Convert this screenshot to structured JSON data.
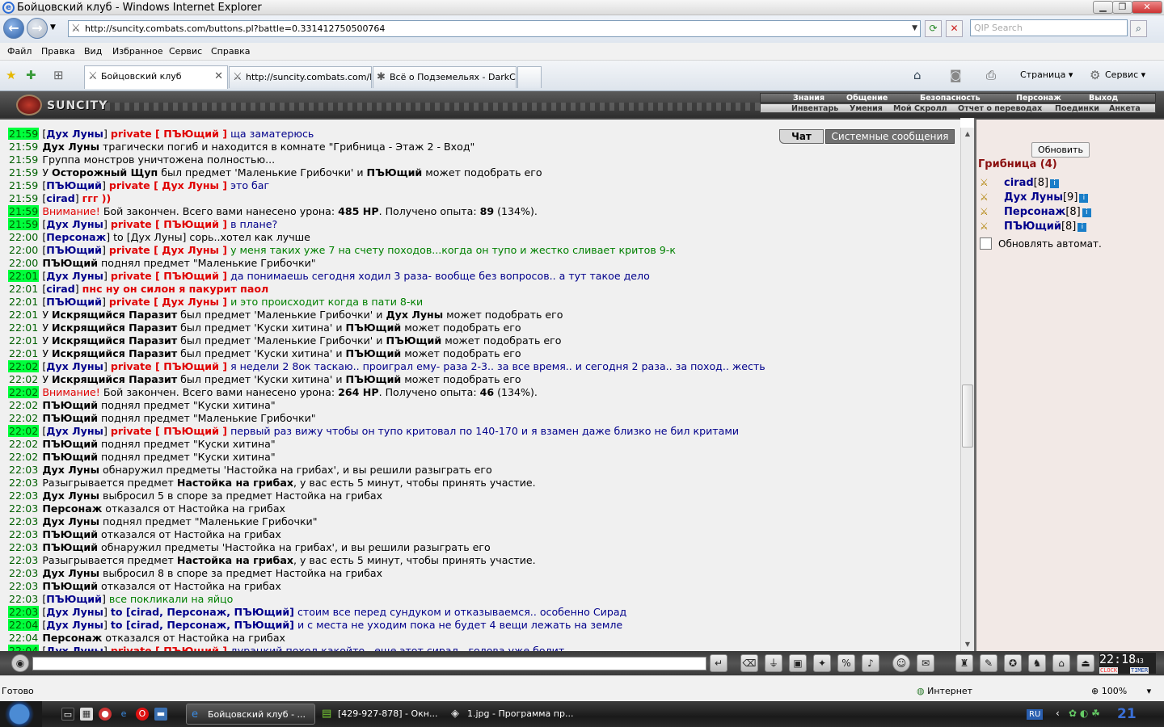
{
  "window": {
    "title": "Бойцовский клуб - Windows Internet Explorer"
  },
  "address": {
    "url": "http://suncity.combats.com/buttons.pl?battle=0.331412750500764",
    "search_placeholder": "QIP Search"
  },
  "menu": [
    "Файл",
    "Правка",
    "Вид",
    "Избранное",
    "Сервис",
    "Справка"
  ],
  "tabs": [
    "Бойцовский клуб",
    "http://suncity.combats.com/l...",
    "Всё о Подземельях - DarkCl..."
  ],
  "toolbar": {
    "page": "Страница",
    "service": "Сервис"
  },
  "game": {
    "logo": "SUNCITY",
    "top_menu": [
      "Знания",
      "Общение",
      "Безопасность",
      "Персонаж",
      "Выход"
    ],
    "sub_menu": [
      "Инвентарь",
      "Умения",
      "Мой Скролл",
      "Отчет о переводах",
      "Поединки",
      "Анкета"
    ]
  },
  "chat_tabs": {
    "chat": "Чат",
    "system": "Системные сообщения"
  },
  "chat": [
    {
      "time": "21:59",
      "hl": true,
      "parts": [
        [
          "t",
          "["
        ],
        [
          "nk",
          "Дух Луны"
        ],
        [
          "t",
          "] "
        ],
        [
          "pr",
          "private [ ПЪЮщий ]"
        ],
        [
          "pm",
          " ща заматерюсь"
        ]
      ]
    },
    {
      "time": "21:59",
      "hl": false,
      "parts": [
        [
          "b",
          "Дух Луны"
        ],
        [
          "t",
          " трагически погиб и находится в комнате \"Грибница - Этаж 2 - Вход\""
        ]
      ]
    },
    {
      "time": "21:59",
      "hl": false,
      "parts": [
        [
          "t",
          "Группа монстров уничтожена полностью..."
        ]
      ]
    },
    {
      "time": "21:59",
      "hl": false,
      "parts": [
        [
          "t",
          "У "
        ],
        [
          "b",
          "Осторожный Щуп"
        ],
        [
          "t",
          " был предмет 'Маленькие Грибочки' и "
        ],
        [
          "b",
          "ПЪЮщий"
        ],
        [
          "t",
          " может подобрать его"
        ]
      ]
    },
    {
      "time": "21:59",
      "hl": false,
      "parts": [
        [
          "t",
          "["
        ],
        [
          "nk",
          "ПЪЮщий"
        ],
        [
          "t",
          "] "
        ],
        [
          "pr",
          "private [ Дух Луны ]"
        ],
        [
          "pm",
          " это баг"
        ]
      ]
    },
    {
      "time": "21:59",
      "hl": false,
      "parts": [
        [
          "t",
          "["
        ],
        [
          "nk",
          "cirad"
        ],
        [
          "t",
          "] "
        ],
        [
          "pr",
          "ггг ))"
        ]
      ]
    },
    {
      "time": "21:59",
      "hl": true,
      "parts": [
        [
          "warn",
          "Внимание!"
        ],
        [
          "t",
          " Бой закончен. Всего вами нанесено урона: "
        ],
        [
          "b",
          "485 HP"
        ],
        [
          "t",
          ". Получено опыта: "
        ],
        [
          "b",
          "89"
        ],
        [
          "t",
          " (134%)."
        ]
      ]
    },
    {
      "time": "21:59",
      "hl": true,
      "parts": [
        [
          "t",
          "["
        ],
        [
          "nk",
          "Дух Луны"
        ],
        [
          "t",
          "] "
        ],
        [
          "pr",
          "private [ ПЪЮщий ]"
        ],
        [
          "pm",
          " в плане?"
        ]
      ]
    },
    {
      "time": "22:00",
      "hl": false,
      "parts": [
        [
          "t",
          "["
        ],
        [
          "nk",
          "Персонаж"
        ],
        [
          "t",
          "] "
        ],
        [
          "t",
          "to [Дух Луны] сорь..хотел как лучше"
        ]
      ]
    },
    {
      "time": "22:00",
      "hl": false,
      "parts": [
        [
          "t",
          "["
        ],
        [
          "nk",
          "ПЪЮщий"
        ],
        [
          "t",
          "] "
        ],
        [
          "pr",
          "private [ Дух Луны ]"
        ],
        [
          "green",
          " у меня таких уже 7 на счету походов...когда он тупо и жестко сливает критов 9-к"
        ]
      ]
    },
    {
      "time": "22:00",
      "hl": false,
      "parts": [
        [
          "b",
          "ПЪЮщий"
        ],
        [
          "t",
          " поднял предмет \"Маленькие Грибочки\""
        ]
      ]
    },
    {
      "time": "22:01",
      "hl": true,
      "parts": [
        [
          "t",
          "["
        ],
        [
          "nk",
          "Дух Луны"
        ],
        [
          "t",
          "] "
        ],
        [
          "pr",
          "private [ ПЪЮщий ]"
        ],
        [
          "pm",
          " да понимаешь сегодня ходил 3 раза- вообще без вопросов.. а тут такое дело"
        ]
      ]
    },
    {
      "time": "22:01",
      "hl": false,
      "parts": [
        [
          "t",
          "["
        ],
        [
          "nk",
          "cirad"
        ],
        [
          "t",
          "] "
        ],
        [
          "pr",
          "пнс ну он силон я пакурит паол"
        ]
      ]
    },
    {
      "time": "22:01",
      "hl": false,
      "parts": [
        [
          "t",
          "["
        ],
        [
          "nk",
          "ПЪЮщий"
        ],
        [
          "t",
          "] "
        ],
        [
          "pr",
          "private [ Дух Луны ]"
        ],
        [
          "green",
          " и это происходит когда в пати 8-ки"
        ]
      ]
    },
    {
      "time": "22:01",
      "hl": false,
      "parts": [
        [
          "t",
          "У "
        ],
        [
          "b",
          "Искрящийся Паразит"
        ],
        [
          "t",
          " был предмет 'Маленькие Грибочки' и "
        ],
        [
          "b",
          "Дух Луны"
        ],
        [
          "t",
          " может подобрать его"
        ]
      ]
    },
    {
      "time": "22:01",
      "hl": false,
      "parts": [
        [
          "t",
          "У "
        ],
        [
          "b",
          "Искрящийся Паразит"
        ],
        [
          "t",
          " был предмет 'Куски хитина' и "
        ],
        [
          "b",
          "ПЪЮщий"
        ],
        [
          "t",
          " может подобрать его"
        ]
      ]
    },
    {
      "time": "22:01",
      "hl": false,
      "parts": [
        [
          "t",
          "У "
        ],
        [
          "b",
          "Искрящийся Паразит"
        ],
        [
          "t",
          " был предмет 'Маленькие Грибочки' и "
        ],
        [
          "b",
          "ПЪЮщий"
        ],
        [
          "t",
          " может подобрать его"
        ]
      ]
    },
    {
      "time": "22:01",
      "hl": false,
      "parts": [
        [
          "t",
          "У "
        ],
        [
          "b",
          "Искрящийся Паразит"
        ],
        [
          "t",
          " был предмет 'Куски хитина' и "
        ],
        [
          "b",
          "ПЪЮщий"
        ],
        [
          "t",
          " может подобрать его"
        ]
      ]
    },
    {
      "time": "22:02",
      "hl": true,
      "parts": [
        [
          "t",
          "["
        ],
        [
          "nk",
          "Дух Луны"
        ],
        [
          "t",
          "] "
        ],
        [
          "pr",
          "private [ ПЪЮщий ]"
        ],
        [
          "pm",
          " я недели 2 8ок таскаю.. проиграл ему- раза 2-3.. за все время.. и сегодня 2 раза.. за поход.. жесть"
        ]
      ]
    },
    {
      "time": "22:02",
      "hl": false,
      "parts": [
        [
          "t",
          "У "
        ],
        [
          "b",
          "Искрящийся Паразит"
        ],
        [
          "t",
          " был предмет 'Куски хитина' и "
        ],
        [
          "b",
          "ПЪЮщий"
        ],
        [
          "t",
          " может подобрать его"
        ]
      ]
    },
    {
      "time": "22:02",
      "hl": true,
      "parts": [
        [
          "warn",
          "Внимание!"
        ],
        [
          "t",
          " Бой закончен. Всего вами нанесено урона: "
        ],
        [
          "b",
          "264 HP"
        ],
        [
          "t",
          ". Получено опыта: "
        ],
        [
          "b",
          "46"
        ],
        [
          "t",
          " (134%)."
        ]
      ]
    },
    {
      "time": "22:02",
      "hl": false,
      "parts": [
        [
          "b",
          "ПЪЮщий"
        ],
        [
          "t",
          " поднял предмет \"Куски хитина\""
        ]
      ]
    },
    {
      "time": "22:02",
      "hl": false,
      "parts": [
        [
          "b",
          "ПЪЮщий"
        ],
        [
          "t",
          " поднял предмет \"Маленькие Грибочки\""
        ]
      ]
    },
    {
      "time": "22:02",
      "hl": true,
      "parts": [
        [
          "t",
          "["
        ],
        [
          "nk",
          "Дух Луны"
        ],
        [
          "t",
          "] "
        ],
        [
          "pr",
          "private [ ПЪЮщий ]"
        ],
        [
          "pm",
          " первый раз вижу чтобы он тупо критовал по 140-170 и я взамен даже близко не бил критами"
        ]
      ]
    },
    {
      "time": "22:02",
      "hl": false,
      "parts": [
        [
          "b",
          "ПЪЮщий"
        ],
        [
          "t",
          " поднял предмет \"Куски хитина\""
        ]
      ]
    },
    {
      "time": "22:02",
      "hl": false,
      "parts": [
        [
          "b",
          "ПЪЮщий"
        ],
        [
          "t",
          " поднял предмет \"Куски хитина\""
        ]
      ]
    },
    {
      "time": "22:03",
      "hl": false,
      "parts": [
        [
          "b",
          "Дух Луны"
        ],
        [
          "t",
          " обнаружил предметы 'Настойка на грибах', и вы решили разыграть его"
        ]
      ]
    },
    {
      "time": "22:03",
      "hl": false,
      "parts": [
        [
          "t",
          "Разыгрывается предмет "
        ],
        [
          "b",
          "Настойка на грибах"
        ],
        [
          "t",
          ", у вас есть 5 минут, чтобы принять участие."
        ]
      ]
    },
    {
      "time": "22:03",
      "hl": false,
      "parts": [
        [
          "b",
          "Дух Луны"
        ],
        [
          "t",
          " выбросил 5 в споре за предмет Настойка на грибах"
        ]
      ]
    },
    {
      "time": "22:03",
      "hl": false,
      "parts": [
        [
          "b",
          "Персонаж"
        ],
        [
          "t",
          " отказался от Настойка на грибах"
        ]
      ]
    },
    {
      "time": "22:03",
      "hl": false,
      "parts": [
        [
          "b",
          "Дух Луны"
        ],
        [
          "t",
          " поднял предмет \"Маленькие Грибочки\""
        ]
      ]
    },
    {
      "time": "22:03",
      "hl": false,
      "parts": [
        [
          "b",
          "ПЪЮщий"
        ],
        [
          "t",
          " отказался от Настойка на грибах"
        ]
      ]
    },
    {
      "time": "22:03",
      "hl": false,
      "parts": [
        [
          "b",
          "ПЪЮщий"
        ],
        [
          "t",
          " обнаружил предметы 'Настойка на грибах', и вы решили разыграть его"
        ]
      ]
    },
    {
      "time": "22:03",
      "hl": false,
      "parts": [
        [
          "t",
          "Разыгрывается предмет "
        ],
        [
          "b",
          "Настойка на грибах"
        ],
        [
          "t",
          ", у вас есть 5 минут, чтобы принять участие."
        ]
      ]
    },
    {
      "time": "22:03",
      "hl": false,
      "parts": [
        [
          "b",
          "Дух Луны"
        ],
        [
          "t",
          " выбросил 8 в споре за предмет Настойка на грибах"
        ]
      ]
    },
    {
      "time": "22:03",
      "hl": false,
      "parts": [
        [
          "b",
          "ПЪЮщий"
        ],
        [
          "t",
          " отказался от Настойка на грибах"
        ]
      ]
    },
    {
      "time": "22:03",
      "hl": false,
      "parts": [
        [
          "t",
          "["
        ],
        [
          "nk",
          "ПЪЮщий"
        ],
        [
          "t",
          "] "
        ],
        [
          "green",
          "все покликали на яйцо"
        ]
      ]
    },
    {
      "time": "22:03",
      "hl": true,
      "parts": [
        [
          "t",
          "["
        ],
        [
          "nk",
          "Дух Луны"
        ],
        [
          "t",
          "] "
        ],
        [
          "nk",
          "to [cirad, Персонаж, ПЪЮщий]"
        ],
        [
          "pm",
          " стоим все перед сундуком и отказываемся.. особенно Сирад"
        ]
      ]
    },
    {
      "time": "22:04",
      "hl": true,
      "parts": [
        [
          "t",
          "["
        ],
        [
          "nk",
          "Дух Луны"
        ],
        [
          "t",
          "] "
        ],
        [
          "nk",
          "to [cirad, Персонаж, ПЪЮщий]"
        ],
        [
          "pm",
          " и с места не уходим пока не будет 4 вещи лежать на земле"
        ]
      ]
    },
    {
      "time": "22:04",
      "hl": false,
      "parts": [
        [
          "b",
          "Персонаж"
        ],
        [
          "t",
          " отказался от Настойка на грибах"
        ]
      ]
    },
    {
      "time": "22:04",
      "hl": true,
      "parts": [
        [
          "t",
          "["
        ],
        [
          "nk",
          "Дух Луны"
        ],
        [
          "t",
          "] "
        ],
        [
          "pr",
          "private [ ПЪЮщий ]"
        ],
        [
          "pm",
          " дурацкий поход какойто.. еще этот сирад.. голова уже болит"
        ]
      ]
    }
  ],
  "room": {
    "button": "Обновить",
    "title": "Грибница (4)",
    "players": [
      {
        "name": "cirad",
        "level": "[8]"
      },
      {
        "name": "Дух Луны",
        "level": "[9]"
      },
      {
        "name": "Персонаж",
        "level": "[8]"
      },
      {
        "name": "ПЪЮщий",
        "level": "[8]"
      }
    ],
    "auto_update": "Обновлять автомат."
  },
  "clock": {
    "time": "22:18",
    "sec": "43",
    "clock_label": "CLOCK",
    "timer_label": "TIMER"
  },
  "status": {
    "left": "Готово",
    "zone": "Интернет",
    "zoom": "100%"
  },
  "taskbar": {
    "items": [
      "Бойцовский клуб - ...",
      "[429-927-878] - Окн...",
      "1.jpg - Программа пр..."
    ],
    "lang": "RU",
    "time": "21"
  }
}
